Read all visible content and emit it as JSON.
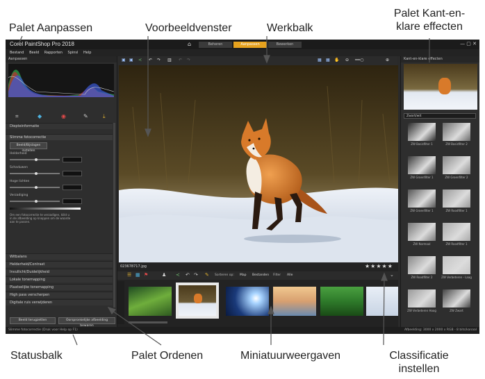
{
  "callouts": {
    "palet_aanpassen": "Palet Aanpassen",
    "voorbeeldvenster": "Voorbeeldvenster",
    "werkbalk": "Werkbalk",
    "palet_kant_line1": "Palet Kant-en-",
    "palet_kant_line2": "klare effecten",
    "statusbalk": "Statusbalk",
    "palet_ordenen": "Palet Ordenen",
    "miniatuurweergaven": "Miniatuurweergaven",
    "classificatie_line1": "Classificatie",
    "classificatie_line2": "instellen"
  },
  "app": {
    "title": "Corel PaintShop Pro 2018",
    "tabs": [
      "Beheren",
      "Aanpassen",
      "Bewerken"
    ],
    "active_tab": "Aanpassen",
    "menu": [
      "Bestand",
      "Beeld",
      "Rapporten",
      "Spinsl",
      "Help"
    ]
  },
  "adjust_palette": {
    "header": "Aanpassen",
    "depth_section": "Diepteinformatie",
    "smart_photo_fix": "Slimme fotocorrectie",
    "suggest_button": "Beeld/Bijslagen instellen",
    "controls": [
      "Helderheid",
      "Schaduwen",
      "Hoge lichten",
      "Verzadiging"
    ],
    "description": "Om een fotocorrectie te verzadigen, klikt u in de afbeelding op knoppen om de waarde aan te passen.",
    "sections": [
      "Witbalans",
      "Helderheid/Contrast",
      "Invullicht/Duidelijkheid",
      "Lokale tonemapping",
      "Plaatselijke tonemapping",
      "High pass verscherpen",
      "Digitale ruis verwijderen"
    ],
    "reset_button": "Beeld terugzetten",
    "apply_button": "Oorspronkelijke afbeelding bewaren"
  },
  "thumbnail_strip": {
    "filename": "023678717.jpg",
    "rating_stars": "★★★★★",
    "controls": [
      "Sorteren op:",
      "Map",
      "Bestanden",
      "Filter",
      "Alle"
    ]
  },
  "effects_palette": {
    "header": "Kant-en-klare effecten",
    "dropdown": "Zwart/wit",
    "effects": [
      "ZW Basisfilter 1",
      "ZW Basisfilter 2",
      "ZW Groenfilter 1",
      "ZW Groenfilter 2",
      "ZW Groenfilter 1",
      "ZW Roodfilter 1",
      "ZW Normaal",
      "ZW Roodfilter 1",
      "ZW Roodfilter 2",
      "ZW Verbeteren - Laag",
      "ZW Verbeteren Hoog",
      "ZW Zwart"
    ]
  },
  "statusbar": {
    "left": "Slimme fotocorrectie  (Druk voor Help op F1)",
    "right": "Afbeelding: 3000 x 2000 x RGB - 8 bits/kanaal"
  },
  "icons": [
    "home-icon",
    "crop-icon",
    "straighten-icon",
    "red-eye-icon",
    "retouch-icon",
    "zoom-icon",
    "histogram-icon",
    "undo-icon",
    "redo-icon",
    "rating-star-icon"
  ]
}
